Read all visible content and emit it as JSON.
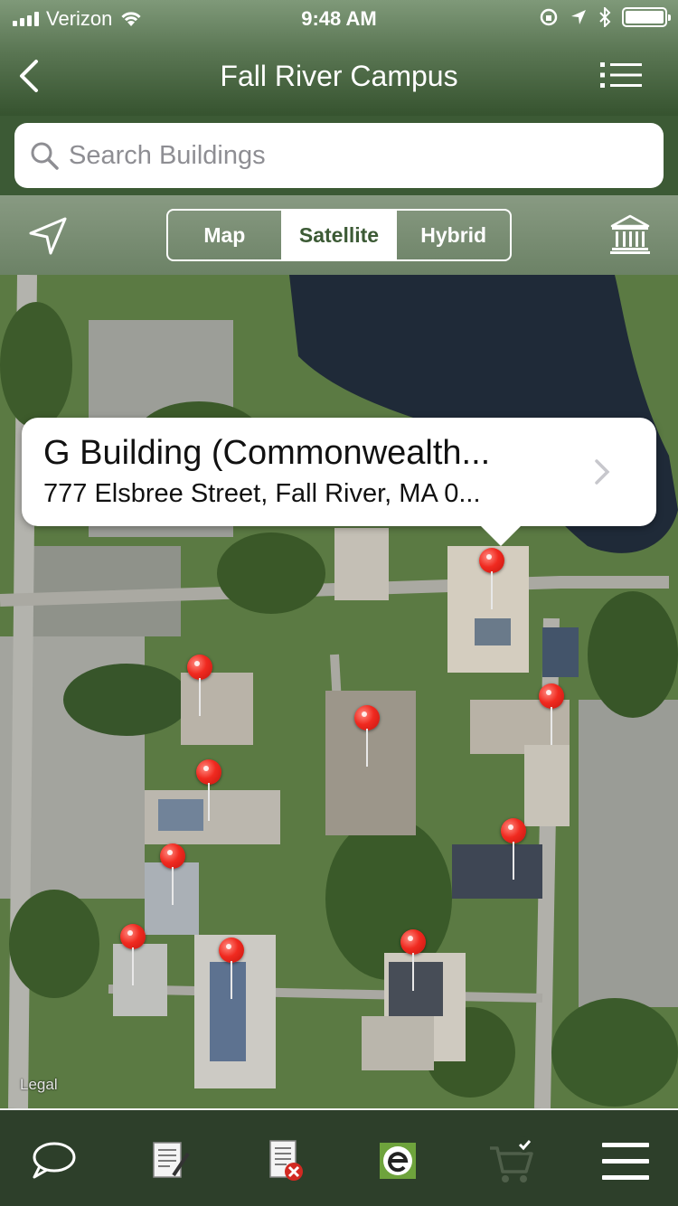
{
  "status_bar": {
    "carrier": "Verizon",
    "time": "9:48 AM",
    "battery_percent": 100
  },
  "header": {
    "title": "Fall River Campus"
  },
  "search": {
    "placeholder": "Search Buildings",
    "value": ""
  },
  "map_type": {
    "options": [
      "Map",
      "Satellite",
      "Hybrid"
    ],
    "selected": "Satellite"
  },
  "map": {
    "legal_label": "Legal",
    "callout": {
      "title": "G Building (Commonwealth...",
      "subtitle": "777 Elsbree Street, Fall River, MA 0..."
    },
    "pin_count": 10
  },
  "tabbar": {
    "icons": [
      "chat-icon",
      "notes-icon",
      "remove-document-icon",
      "e-app-icon",
      "cart-icon",
      "menu-icon"
    ]
  },
  "colors": {
    "header_green": "#3c5a35",
    "tabbar_green": "#2d3f2a",
    "pin_red": "#f02a20"
  }
}
